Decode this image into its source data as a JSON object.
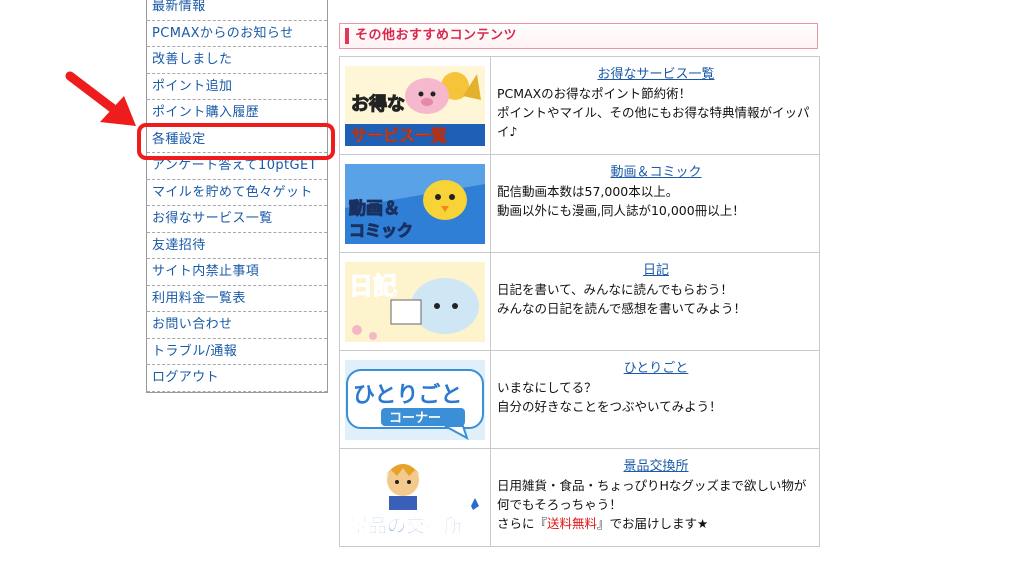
{
  "sidebar": {
    "items": [
      {
        "label": "最新情報"
      },
      {
        "label": "PCMAXからのお知らせ"
      },
      {
        "label": "改善しました"
      },
      {
        "label": "ポイント追加"
      },
      {
        "label": "ポイント購入履歴"
      },
      {
        "label": "各種設定"
      },
      {
        "label": "アンケート答えて10ptGET"
      },
      {
        "label": "マイルを貯めて色々ゲット"
      },
      {
        "label": "お得なサービス一覧"
      },
      {
        "label": "友達招待"
      },
      {
        "label": "サイト内禁止事項"
      },
      {
        "label": "利用料金一覧表"
      },
      {
        "label": "お問い合わせ"
      },
      {
        "label": "トラブル/通報"
      },
      {
        "label": "ログアウト"
      }
    ]
  },
  "section": {
    "title": "その他おすすめコンテンツ"
  },
  "contents": [
    {
      "title": "お得なサービス一覧",
      "thumb_text": [
        "お得な",
        "サービス一覧"
      ],
      "lines": [
        "PCMAXのお得なポイント節約術！",
        "ポイントやマイル、その他にもお得な特典情報がイッパイ♪"
      ]
    },
    {
      "title": "動画＆コミック",
      "thumb_text": [
        "動画＆",
        "コミック"
      ],
      "lines": [
        "配信動画本数は57,000本以上。",
        "動画以外にも漫画,同人誌が10,000冊以上！"
      ]
    },
    {
      "title": "日記",
      "thumb_text": [
        "日記"
      ],
      "lines": [
        "日記を書いて、みんなに読んでもらおう！",
        "みんなの日記を読んで感想を書いてみよう！"
      ]
    },
    {
      "title": "ひとりごと",
      "thumb_text": [
        "ひとりごと",
        "コーナー"
      ],
      "lines": [
        "いまなにしてる？",
        "自分の好きなことをつぶやいてみよう！"
      ]
    },
    {
      "title": "景品交換所",
      "thumb_text": [
        "景品の交換所"
      ],
      "lines": [
        "日用雑貨・食品・ちょっぴりHなグッズまで欲しい物が何でもそろっちゃう！"
      ],
      "last_line": {
        "prefix": "さらに『",
        "highlight": "送料無料",
        "suffix": "』でお届けします★"
      }
    }
  ],
  "colors": {
    "link": "#1a5aa8",
    "accent": "#d8284c",
    "annotation": "#ee1c1c"
  }
}
